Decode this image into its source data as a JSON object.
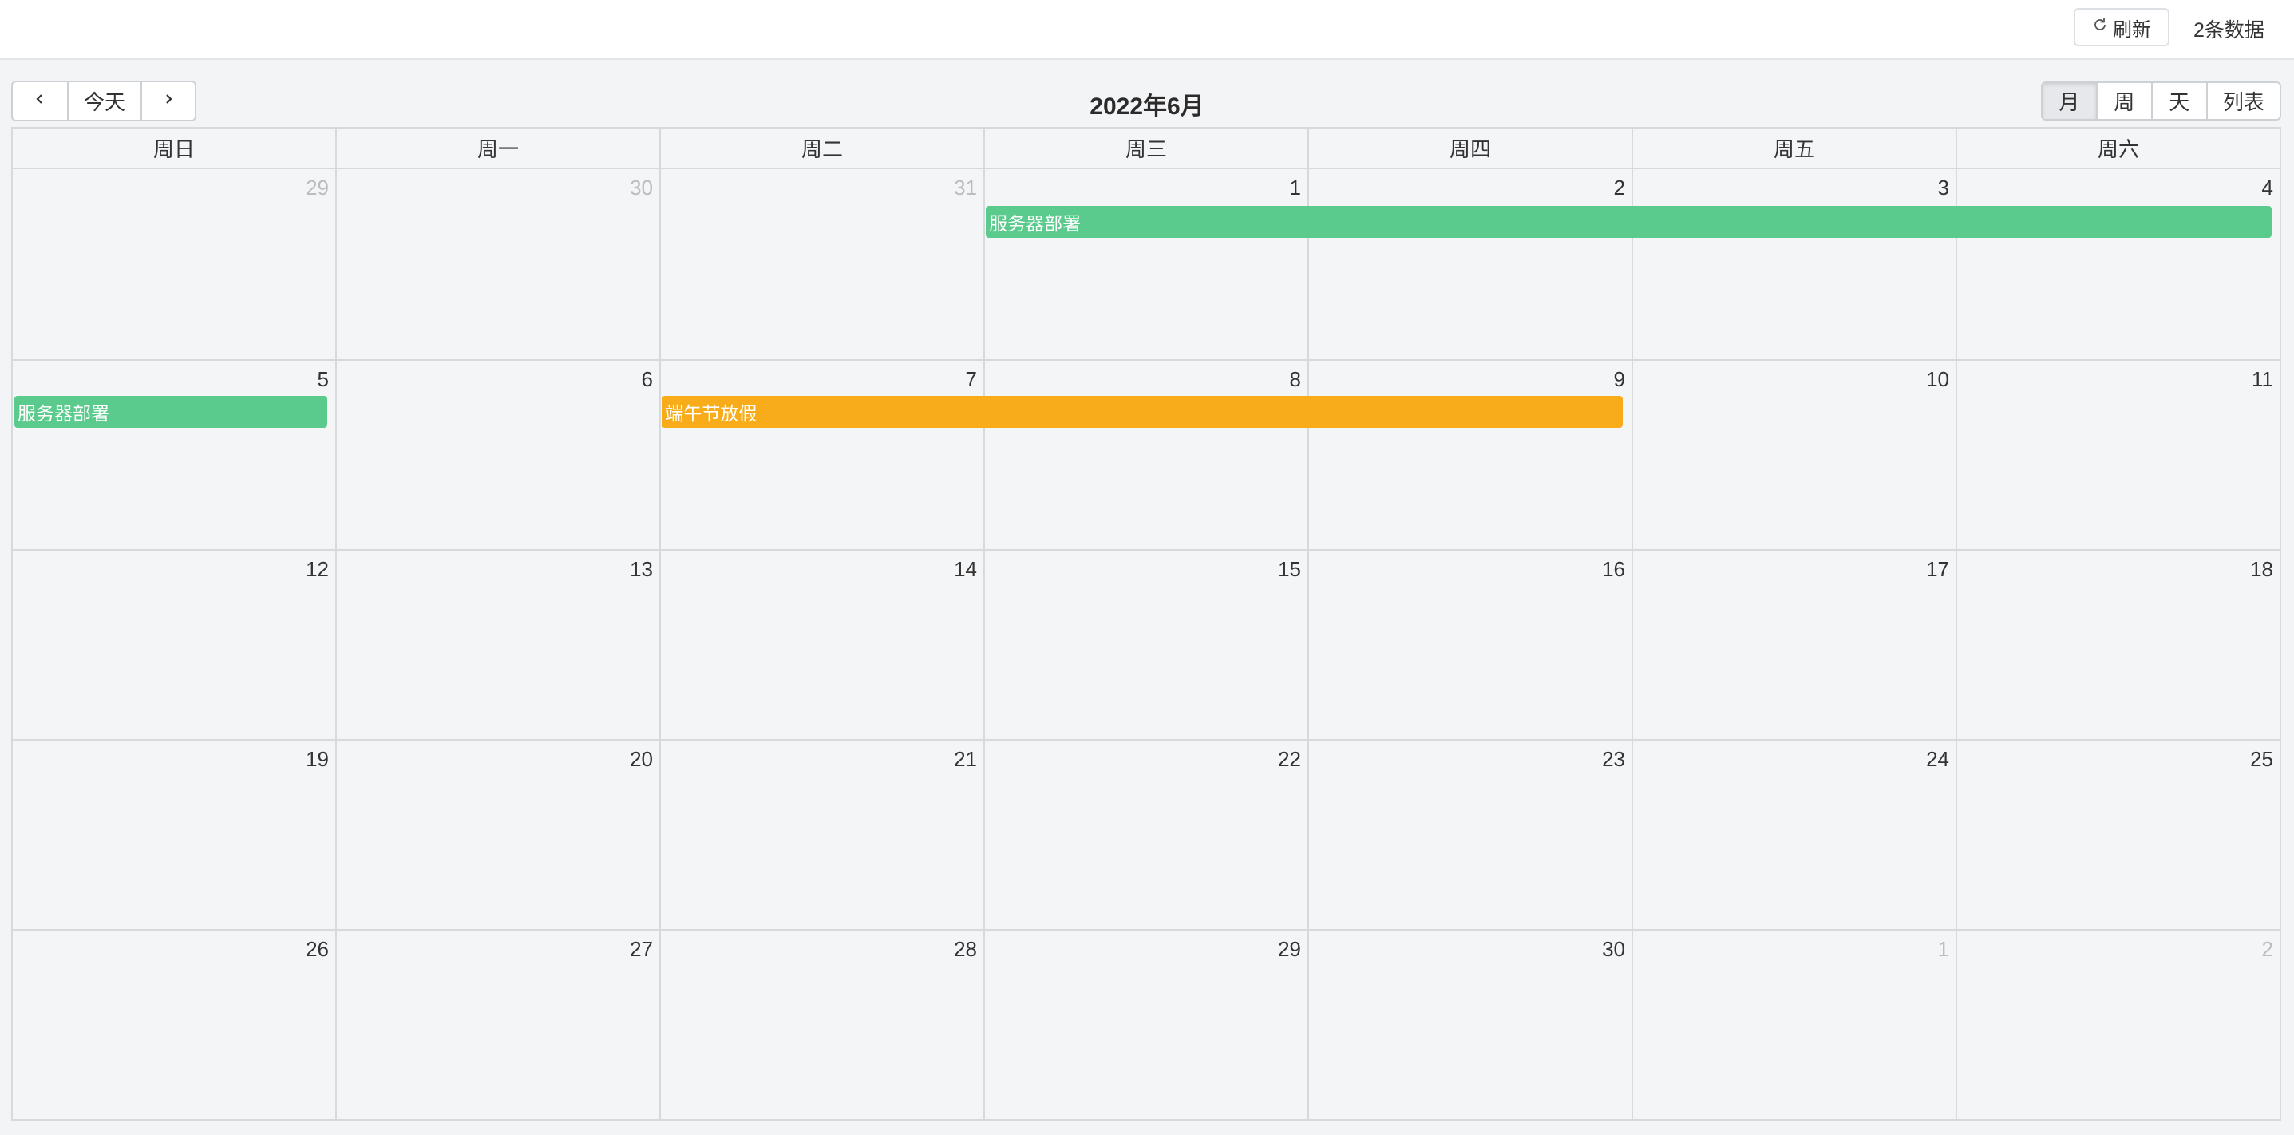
{
  "header": {
    "refresh_label": "刷新",
    "count_label": "2条数据"
  },
  "toolbar": {
    "today_label": "今天",
    "title": "2022年6月",
    "views": [
      "月",
      "周",
      "天",
      "列表"
    ],
    "active_view": "月"
  },
  "weekdays": [
    "周日",
    "周一",
    "周二",
    "周三",
    "周四",
    "周五",
    "周六"
  ],
  "weeks": [
    [
      {
        "n": "29",
        "other": true
      },
      {
        "n": "30",
        "other": true
      },
      {
        "n": "31",
        "other": true
      },
      {
        "n": "1"
      },
      {
        "n": "2"
      },
      {
        "n": "3"
      },
      {
        "n": "4"
      }
    ],
    [
      {
        "n": "5"
      },
      {
        "n": "6"
      },
      {
        "n": "7"
      },
      {
        "n": "8"
      },
      {
        "n": "9"
      },
      {
        "n": "10"
      },
      {
        "n": "11"
      }
    ],
    [
      {
        "n": "12"
      },
      {
        "n": "13"
      },
      {
        "n": "14"
      },
      {
        "n": "15"
      },
      {
        "n": "16"
      },
      {
        "n": "17"
      },
      {
        "n": "18"
      }
    ],
    [
      {
        "n": "19"
      },
      {
        "n": "20"
      },
      {
        "n": "21"
      },
      {
        "n": "22"
      },
      {
        "n": "23"
      },
      {
        "n": "24"
      },
      {
        "n": "25"
      }
    ],
    [
      {
        "n": "26"
      },
      {
        "n": "27"
      },
      {
        "n": "28"
      },
      {
        "n": "29"
      },
      {
        "n": "30"
      },
      {
        "n": "1",
        "other": true
      },
      {
        "n": "2",
        "other": true
      }
    ]
  ],
  "events": [
    {
      "title": "服务器部署",
      "color": "#5bcb8d"
    },
    {
      "title": "服务器部署",
      "color": "#5bcb8d"
    },
    {
      "title": "端午节放假",
      "color": "#f8ac1a"
    }
  ],
  "colors": {
    "event_green": "#5bcb8d",
    "event_orange": "#f8ac1a"
  }
}
